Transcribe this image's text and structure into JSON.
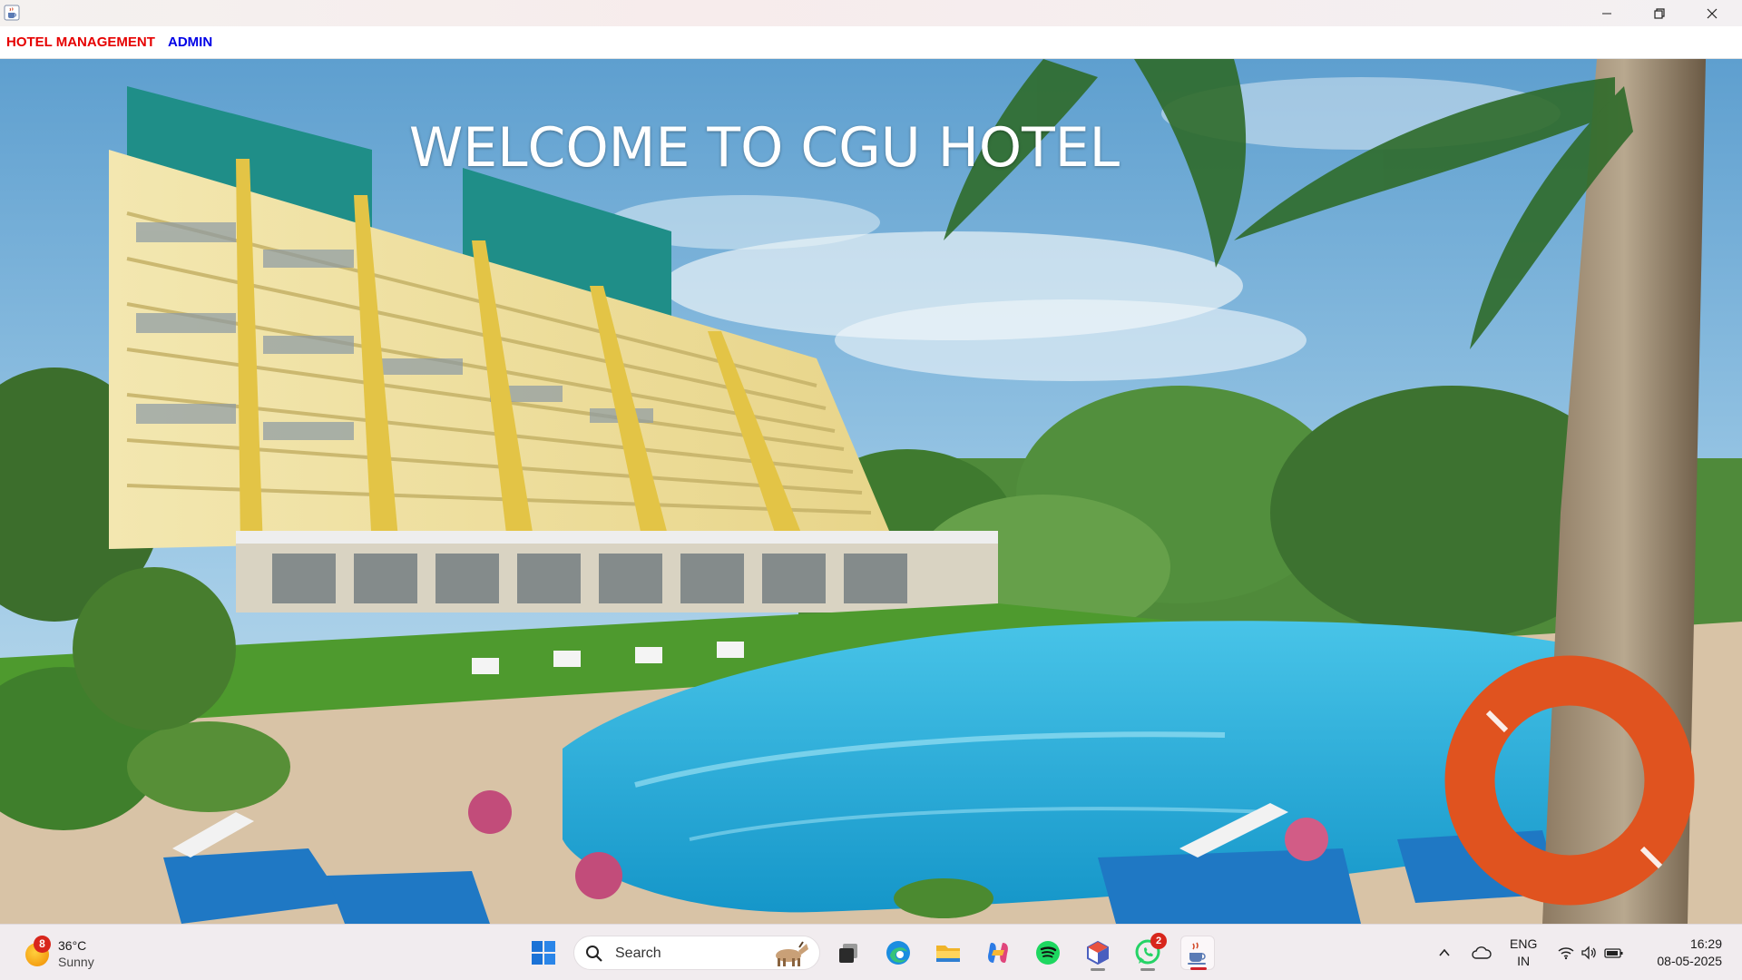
{
  "window": {
    "title_icon": "java-cup-icon",
    "controls": [
      "minimize-icon",
      "maximize-icon",
      "close-icon"
    ]
  },
  "menubar": {
    "items": [
      {
        "label": "HOTEL MANAGEMENT",
        "color": "#e60000"
      },
      {
        "label": "ADMIN",
        "color": "#0000e6"
      }
    ]
  },
  "hero": {
    "heading": "WELCOME TO CGU HOTEL",
    "image": "hotel-pool-photo"
  },
  "taskbar": {
    "weather": {
      "temperature": "36°C",
      "condition": "Sunny",
      "badge": "8"
    },
    "search": {
      "placeholder": "Search"
    },
    "apps": [
      {
        "name": "start-button",
        "icon": "windows-logo-icon"
      },
      {
        "name": "task-view",
        "icon": "task-view-icon"
      },
      {
        "name": "edge",
        "icon": "edge-icon"
      },
      {
        "name": "file-explorer",
        "icon": "folder-icon"
      },
      {
        "name": "copilot",
        "icon": "copilot-icon"
      },
      {
        "name": "spotify",
        "icon": "spotify-icon"
      },
      {
        "name": "app-cube",
        "icon": "cube-icon"
      },
      {
        "name": "whatsapp",
        "icon": "whatsapp-icon",
        "badge": "2"
      },
      {
        "name": "java",
        "icon": "java-cup-icon"
      }
    ],
    "tray": {
      "language_line1": "ENG",
      "language_line2": "IN",
      "time": "16:29",
      "date": "08-05-2025"
    }
  }
}
